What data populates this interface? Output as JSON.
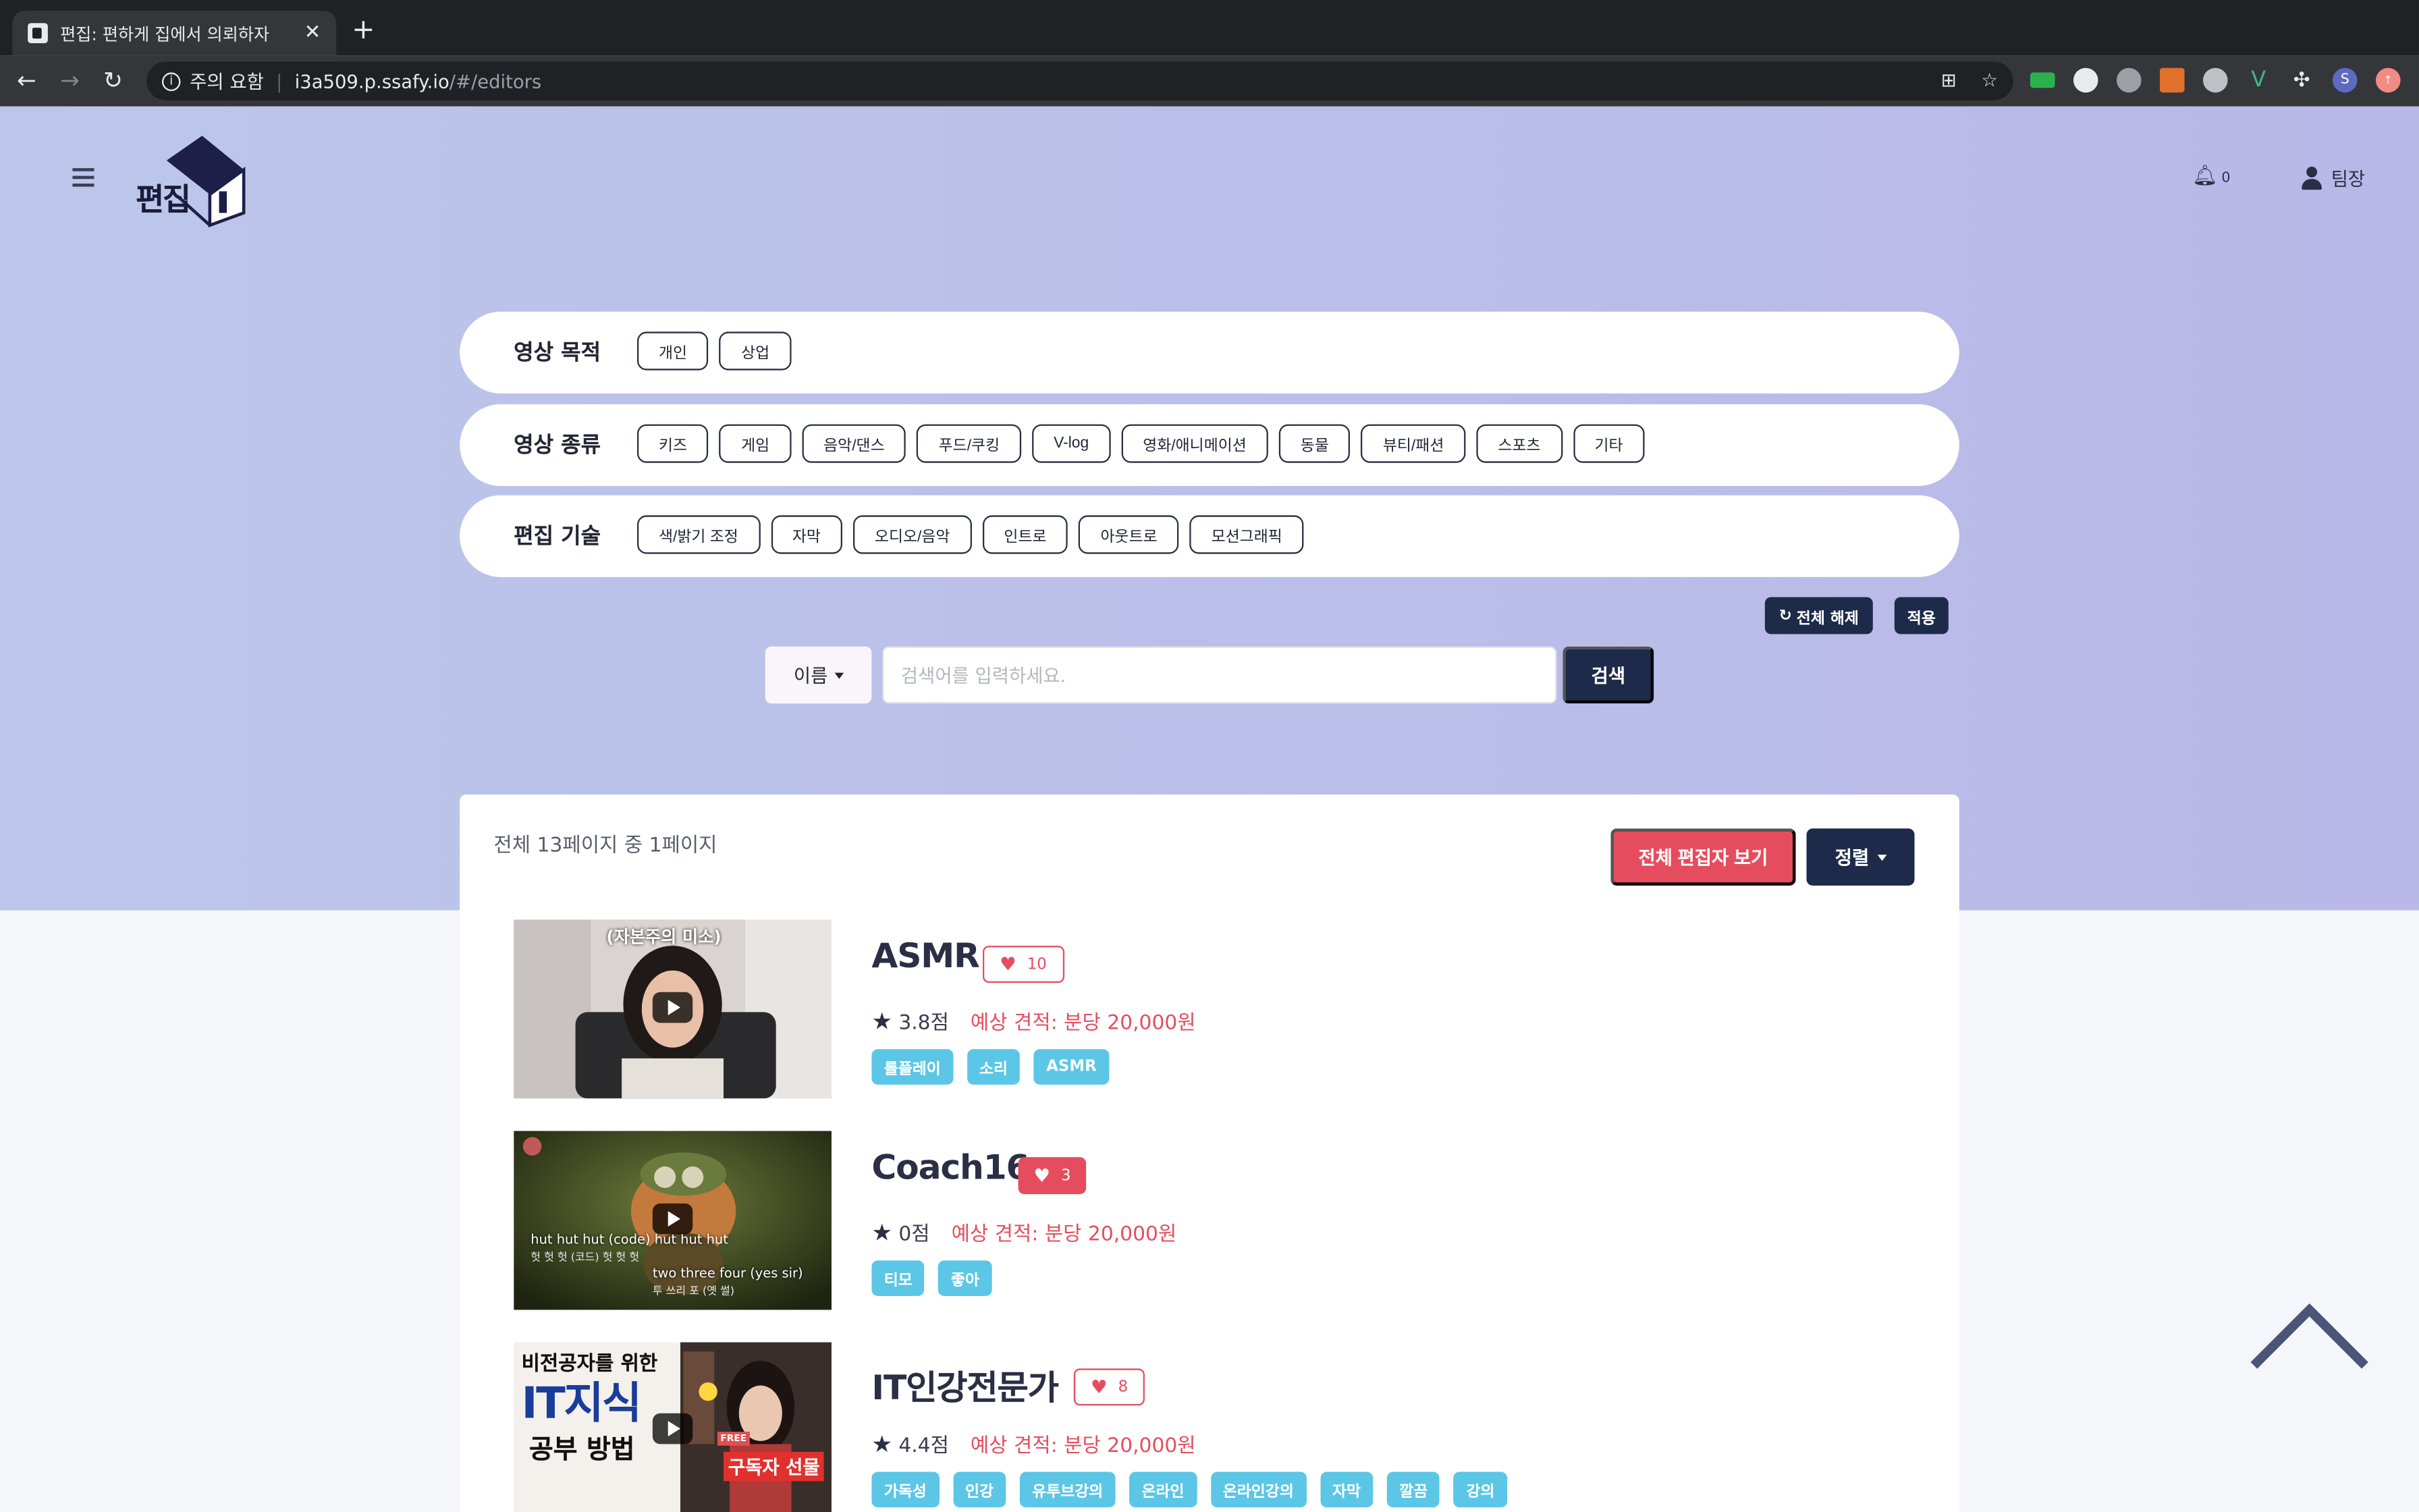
{
  "browser": {
    "tab_title": "편집: 편하게 집에서 의뢰하자",
    "security_label": "주의 요함",
    "url_host": "i3a509.p.ssafy.io",
    "url_path": "/#/editors"
  },
  "header": {
    "logo_text": "편집",
    "notification_count": "0",
    "user_name": "팀장"
  },
  "filters": [
    {
      "label": "영상 목적",
      "options": [
        "개인",
        "상업"
      ]
    },
    {
      "label": "영상 종류",
      "options": [
        "키즈",
        "게임",
        "음악/댄스",
        "푸드/쿠킹",
        "V-log",
        "영화/애니메이션",
        "동물",
        "뷰티/패션",
        "스포츠",
        "기타"
      ]
    },
    {
      "label": "편집 기술",
      "options": [
        "색/밝기 조정",
        "자막",
        "오디오/음악",
        "인트로",
        "아웃트로",
        "모션그래픽"
      ]
    }
  ],
  "filter_actions": {
    "reset_label": "전체 해제",
    "apply_label": "적용"
  },
  "search": {
    "type_label": "이름",
    "placeholder": "검색어를 입력하세요.",
    "button_label": "검색"
  },
  "results": {
    "page_info": "전체 13페이지 중 1페이지",
    "view_all_label": "전체 편집자 보기",
    "sort_label": "정렬"
  },
  "editors": [
    {
      "name": "ASMR",
      "likes": "10",
      "rating": "3.8점",
      "price": "예상 견적: 분당 20,000원",
      "tags": [
        "롤플레이",
        "소리",
        "ASMR"
      ],
      "thumb_caption": "(자본주의 미소)"
    },
    {
      "name": "Coach16",
      "likes": "3",
      "rating": "0점",
      "price": "예상 견적: 분당 20,000원",
      "tags": [
        "티모",
        "좋아"
      ],
      "thumb_caption": "hut hut hut (code) hut hut hut",
      "thumb_caption_sub": "헛 헛 헛 (코드) 헛 헛 헛",
      "thumb_caption2": "two three four (yes sir)",
      "thumb_caption2_sub": "투 쓰리 포 (옛 썰)"
    },
    {
      "name": "IT인강전문가",
      "likes": "8",
      "rating": "4.4점",
      "price": "예상 견적: 분당 20,000원",
      "tags": [
        "가독성",
        "인강",
        "유투브강의",
        "온라인",
        "온라인강의",
        "자막",
        "깔끔",
        "강의"
      ],
      "thumb_line1": "비전공자를 위한",
      "thumb_line2": "IT지식",
      "thumb_line3": "공부 방법",
      "thumb_badge": "구독자 선물",
      "thumb_free": "FREE"
    }
  ],
  "colors": {
    "accent_red": "#e54d5e",
    "navy": "#1e2a4a",
    "tag_blue": "#5bc6e6"
  }
}
